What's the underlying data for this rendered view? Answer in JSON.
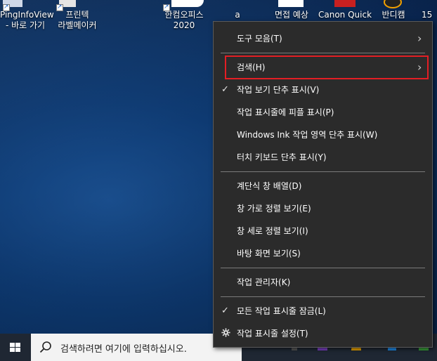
{
  "desktop_icons": [
    {
      "label_line1": "PingInfoView",
      "label_line2": "- 바로 가기"
    },
    {
      "label_line1": "프린텍",
      "label_line2": "라벨메이커"
    },
    {
      "label_line1": "한컴오피스",
      "label_line2": "2020"
    },
    {
      "label_line1": "a",
      "label_line2": ""
    },
    {
      "label_line1": "면접 예상",
      "label_line2": ""
    },
    {
      "label_line1": "Canon Quick",
      "label_line2": ""
    },
    {
      "label_line1": "반디캠",
      "label_line2": ""
    },
    {
      "label_line1": "15",
      "label_line2": ""
    }
  ],
  "context_menu": {
    "items": [
      {
        "label": "도구 모음(T)",
        "submenu": true,
        "checked": false
      },
      {
        "label": "검색(H)",
        "submenu": true,
        "checked": false,
        "highlighted": true
      },
      {
        "label": "작업 보기 단추 표시(V)",
        "checked": true
      },
      {
        "label": "작업 표시줄에 피플 표시(P)",
        "checked": false
      },
      {
        "label": "Windows Ink 작업 영역 단추 표시(W)",
        "checked": false
      },
      {
        "label": "터치 키보드 단추 표시(Y)",
        "checked": false
      },
      {
        "label": "계단식 창 배열(D)",
        "checked": false
      },
      {
        "label": "창 가로 정렬 보기(E)",
        "checked": false
      },
      {
        "label": "창 세로 정렬 보기(I)",
        "checked": false
      },
      {
        "label": "바탕 화면 보기(S)",
        "checked": false
      },
      {
        "label": "작업 관리자(K)",
        "checked": false
      },
      {
        "label": "모든 작업 표시줄 잠금(L)",
        "checked": true
      },
      {
        "label": "작업 표시줄 설정(T)",
        "checked": false,
        "icon": "gear-icon"
      }
    ],
    "check_glyph": "✓",
    "chevron_glyph": "›",
    "highlight_color": "#e31e24"
  },
  "taskbar": {
    "search_placeholder": "검색하려면 여기에 입력하십시오.",
    "start_icon": "windows-logo-icon",
    "search_icon": "search-icon"
  }
}
